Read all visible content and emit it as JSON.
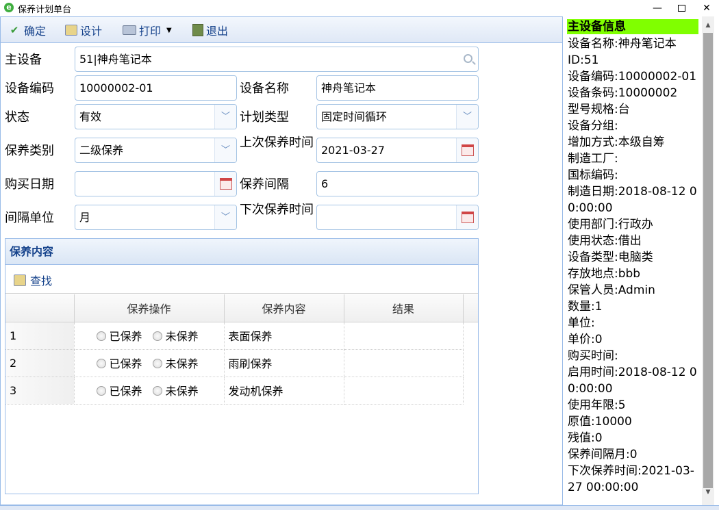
{
  "window": {
    "title": "保养计划单台",
    "minimize": "—",
    "close": "✕"
  },
  "toolbar": {
    "ok": "确定",
    "design": "设计",
    "print": "打印",
    "exit": "退出",
    "print_arrow": "▼"
  },
  "form": {
    "main_device_label": "主设备",
    "main_device_value": "51|神舟笔记本",
    "code_label": "设备编码",
    "code_value": "10000002-01",
    "name_label": "设备名称",
    "name_value": "神舟笔记本",
    "status_label": "状态",
    "status_value": "有效",
    "plan_type_label": "计划类型",
    "plan_type_value": "固定时间循环",
    "maint_type_label": "保养类别",
    "maint_type_value": "二级保养",
    "last_time_label": "上次保养时间",
    "last_time_value": "2021-03-27",
    "buy_date_label": "购买日期",
    "buy_date_value": "",
    "interval_label": "保养间隔",
    "interval_value": "6",
    "unit_label": "间隔单位",
    "unit_value": "月",
    "next_time_label": "下次保养时间",
    "next_time_value": ""
  },
  "panel": {
    "title": "保养内容",
    "find_label": "查找",
    "columns": [
      "保养操作",
      "保养内容",
      "结果"
    ],
    "radio_done": "已保养",
    "radio_not": "未保养",
    "rows": [
      {
        "num": "1",
        "content": "表面保养",
        "result": ""
      },
      {
        "num": "2",
        "content": "雨刷保养",
        "result": ""
      },
      {
        "num": "3",
        "content": "发动机保养",
        "result": ""
      }
    ]
  },
  "side": {
    "title": "主设备信息",
    "lines": [
      "设备名称:神舟笔记本",
      "ID:51",
      "设备编码:10000002-01",
      "设备条码:10000002",
      "型号规格:台",
      "设备分组:",
      "增加方式:本级自筹",
      "制造工厂:",
      "国标编码:",
      "制造日期:2018-08-12 00:00:00",
      "使用部门:行政办",
      "使用状态:借出",
      "设备类型:电脑类",
      "存放地点:bbb",
      "保管人员:Admin",
      "数量:1",
      "单位:",
      "单价:0",
      "购买时间:",
      "启用时间:2018-08-12 00:00:00",
      "使用年限:5",
      "原值:10000",
      "残值:0",
      "保养间隔月:0",
      "下次保养时间:2021-03-27 00:00:00"
    ]
  },
  "colors": {
    "accent": "#15428b",
    "border": "#99bbe8",
    "side_header_bg": "#80ff00"
  }
}
